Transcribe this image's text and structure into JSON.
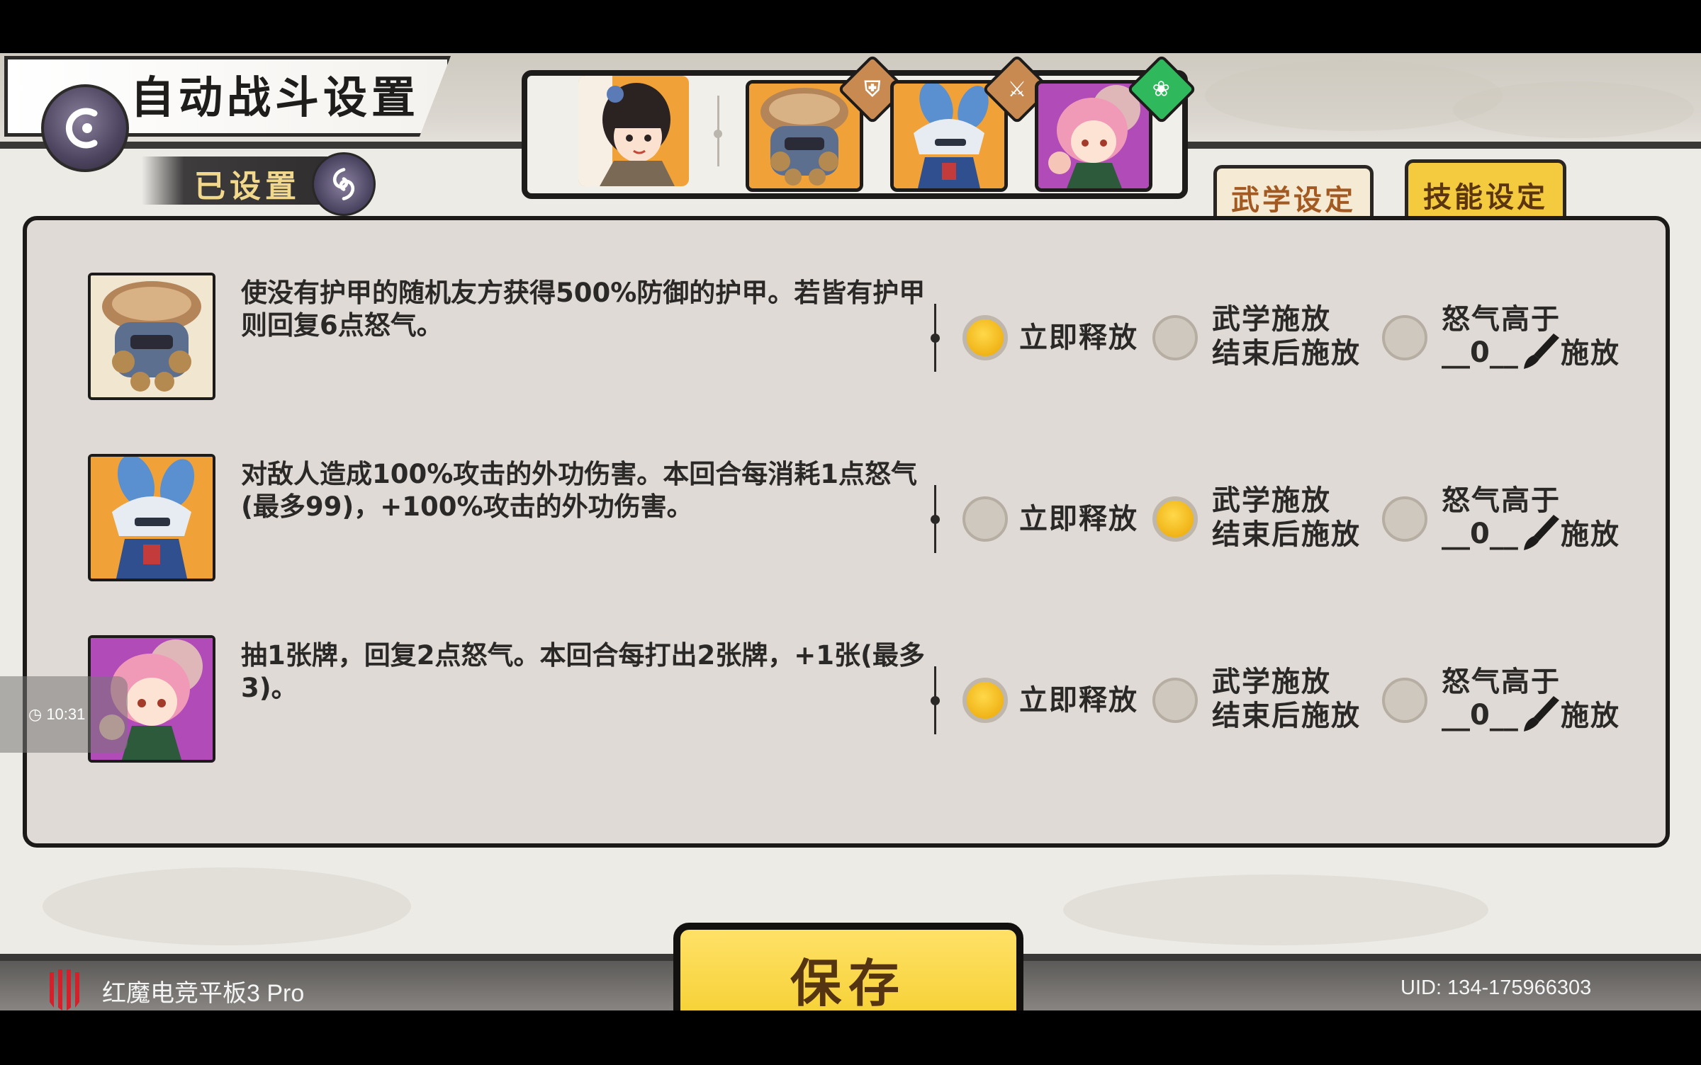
{
  "header": {
    "title": "自动战斗设置",
    "configured_label": "已设置"
  },
  "heroes": [
    {
      "name": "hero-girl-portrait",
      "selected": true,
      "badge": null,
      "bg": "#f0a238"
    },
    {
      "name": "hero-nest-portrait",
      "selected": false,
      "badge": "shield-icon",
      "badge_color": "#c98a52",
      "bg": "#f0a238"
    },
    {
      "name": "hero-masked-portrait",
      "selected": false,
      "badge": "sword-icon",
      "badge_color": "#c98a52",
      "bg": "#f0a238"
    },
    {
      "name": "hero-pink-portrait",
      "selected": false,
      "badge": "leaf-icon",
      "badge_color": "#2fb85c",
      "bg": "#b04bb8"
    }
  ],
  "tabs": {
    "martial": "武学设定",
    "skill": "技能设定"
  },
  "options": {
    "immediate": "立即释放",
    "after_line1": "武学施放",
    "after_line2": "结束后施放",
    "rage_line1": "怒气高于",
    "rage_suffix": "施放"
  },
  "skills": [
    {
      "description": "使没有护甲的随机友方获得500%防御的护甲。若皆有护甲则回复6点怒气。",
      "selected": "immediate",
      "rage_threshold": "__0__"
    },
    {
      "description": "对敌人造成100%攻击的外功伤害。本回合每消耗1点怒气(最多99)，+100%攻击的外功伤害。",
      "selected": "after",
      "rage_threshold": "__0__"
    },
    {
      "description": "抽1张牌，回复2点怒气。本回合每打出2张牌，+1张(最多3)。",
      "selected": "immediate",
      "rage_threshold": "__0__"
    }
  ],
  "clock": "10:31",
  "save_label": "保存",
  "footer": {
    "device": "红魔电竞平板3 Pro",
    "uid": "UID:  134-175966303"
  },
  "colors": {
    "accent_yellow": "#f4cb3f",
    "panel_bg": "#dfdad5",
    "radio_on": "#f0b417"
  }
}
